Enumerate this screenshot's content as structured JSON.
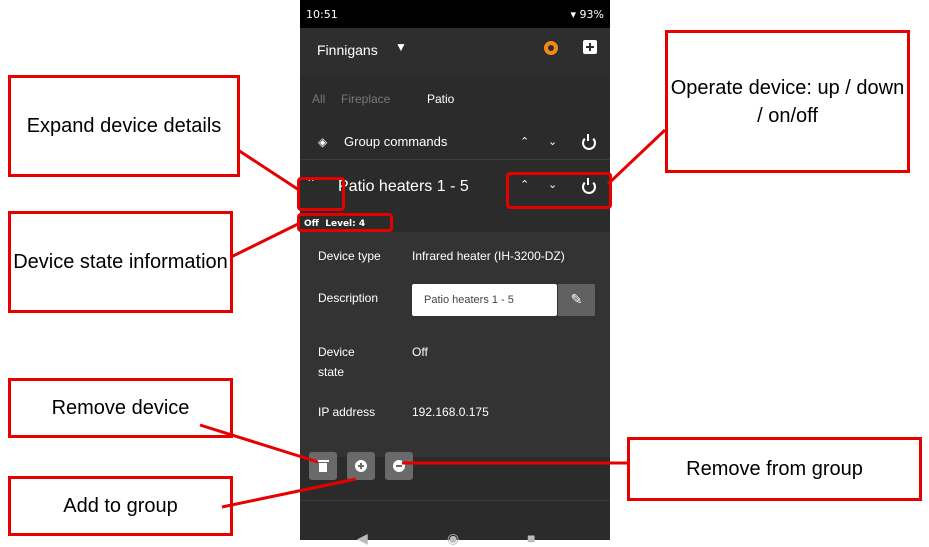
{
  "status_bar": {
    "time": "10:51",
    "battery": "93%"
  },
  "app_bar": {
    "venue": "Finnigans"
  },
  "tabs": [
    "All",
    "Fireplace",
    "Patio"
  ],
  "group": {
    "label": "Group commands"
  },
  "device": {
    "title": "Patio heaters 1 - 5",
    "state_text": "Off",
    "level_text": "Level: 4",
    "fields": {
      "type_label": "Device type",
      "type_value": "Infrared heater (IH-3200-DZ)",
      "desc_label": "Description",
      "desc_value": "Patio heaters 1 - 5",
      "state_label_1": "Device",
      "state_label_2": "state",
      "state_value": "Off",
      "ip_label": "IP address",
      "ip_value": "192.168.0.175"
    }
  },
  "callouts": {
    "expand": "Expand device details",
    "operate": "Operate device: up / down / on/off",
    "state": "Device state information",
    "remove_device": "Remove device",
    "add_group": "Add to group",
    "remove_group": "Remove from group"
  },
  "colors": {
    "highlight": "#e60000",
    "panel": "#2b2b2b",
    "orange": "#f08a1a"
  }
}
